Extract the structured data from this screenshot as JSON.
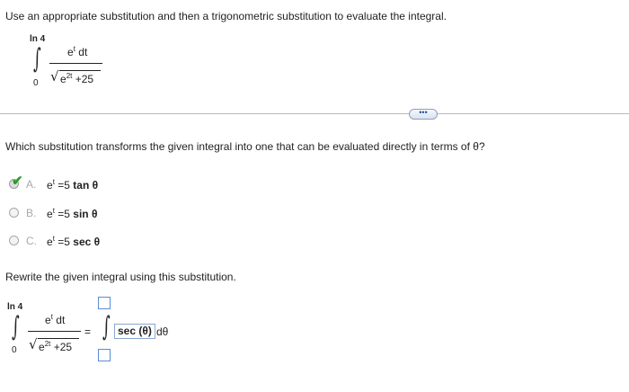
{
  "question": {
    "instruction": "Use an appropriate substitution and then a trigonometric substitution to evaluate the integral.",
    "integral": {
      "upper_limit": "ln 4",
      "lower_limit": "0",
      "numerator_base": "e",
      "numerator_exp": "t",
      "numerator_dt": "dt",
      "denominator_base": "e",
      "denominator_exp": "2t",
      "denominator_rest": "+25"
    }
  },
  "more_button": {
    "label": "•••"
  },
  "part1": {
    "prompt": "Which substitution transforms the given integral into one that can be evaluated directly in terms of θ?",
    "options": [
      {
        "letter": "A.",
        "lhs_base": "e",
        "lhs_exp": "t",
        "rhs": "=5",
        "func": "tan θ",
        "selected": true
      },
      {
        "letter": "B.",
        "lhs_base": "e",
        "lhs_exp": "t",
        "rhs": "=5",
        "func": "sin θ",
        "selected": false
      },
      {
        "letter": "C.",
        "lhs_base": "e",
        "lhs_exp": "t",
        "rhs": "=5",
        "func": "sec θ",
        "selected": false
      }
    ]
  },
  "part2": {
    "prompt": "Rewrite the given integral using this substitution.",
    "equals": "=",
    "filled_integrand": "sec (θ)",
    "dtheta": "dθ",
    "upper_limit_value": "",
    "lower_limit_value": ""
  }
}
